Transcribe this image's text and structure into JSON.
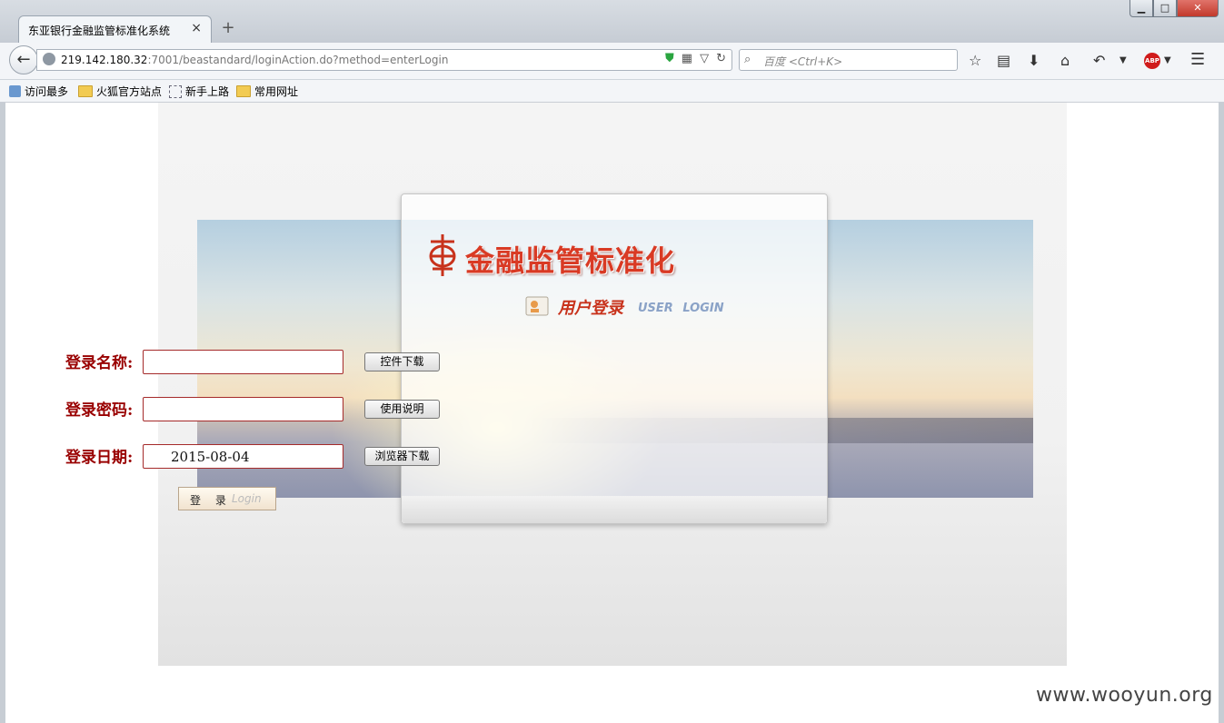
{
  "browser": {
    "tab_title": "东亚银行金融监管标准化系统",
    "tab_close": "×",
    "new_tab": "+",
    "window_buttons": {
      "minimize": "▁",
      "maximize": "□",
      "close": "✕"
    },
    "url_host": "219.142.180.32",
    "url_rest": ":7001/beastandard/loginAction.do?method=enterLogin",
    "search_placeholder": "百度 <Ctrl+K>",
    "toolbar_icons": [
      "star-icon",
      "reading-list-icon",
      "download-icon",
      "home-icon",
      "undo-icon",
      "menu-icon"
    ],
    "abp_label": "ABP",
    "bookmarks": [
      "访问最多",
      "火狐官方站点",
      "新手上路",
      "常用网址"
    ]
  },
  "login": {
    "logo_text": "金融监管标准化",
    "title": "用户登录",
    "title_en": "USER LOGIN",
    "fields": {
      "username_label": "登录名称:",
      "password_label": "登录密码:",
      "date_label": "登录日期:",
      "username_value": "",
      "password_value": "",
      "date_value": "2015-08-04"
    },
    "buttons": {
      "control_download": "控件下载",
      "instructions": "使用说明",
      "browser_download": "浏览器下载",
      "login_cn": "登 录",
      "login_en": "Login"
    }
  },
  "watermark": "www.wooyun.org",
  "colors": {
    "label": "#990000",
    "logo": "#d93a24",
    "input_border": "#a52a2a"
  }
}
